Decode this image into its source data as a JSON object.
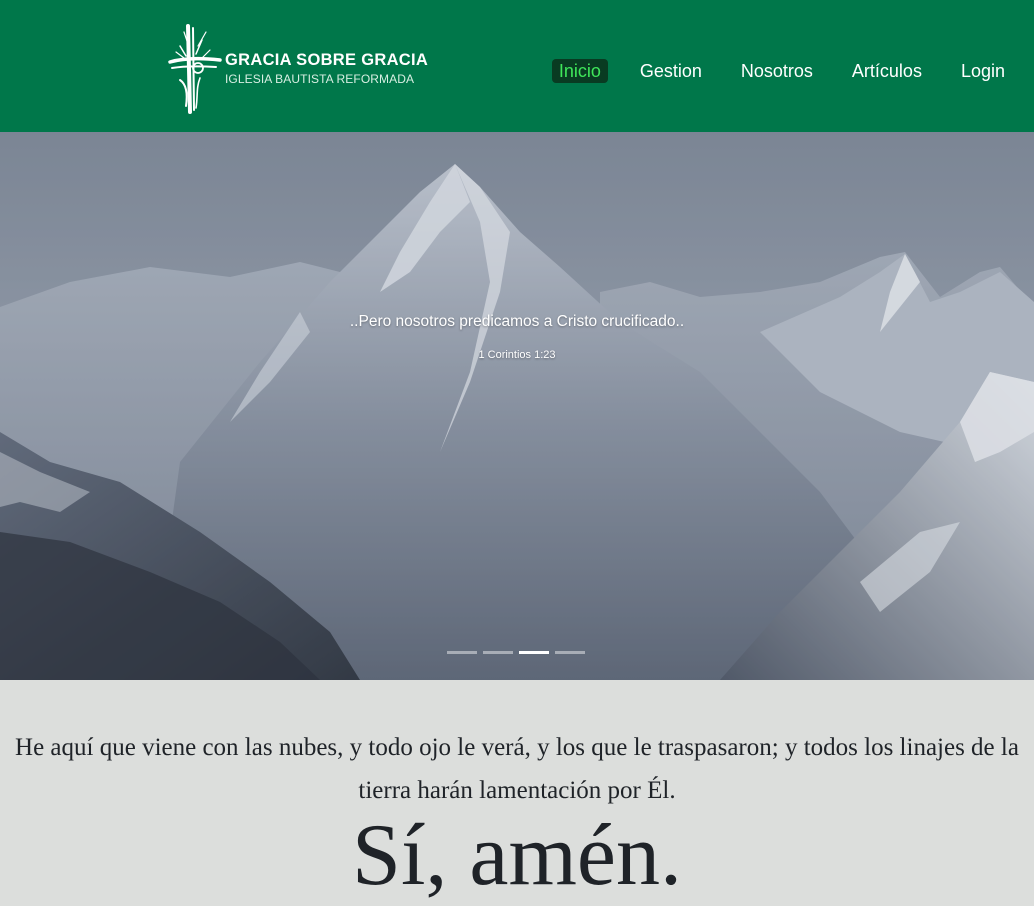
{
  "brand": {
    "title": "GRACIA SOBRE GRACIA",
    "subtitle": "IGLESIA BAUTISTA REFORMADA",
    "icon": "cross-logo-icon"
  },
  "nav": {
    "items": [
      {
        "label": "Inicio",
        "active": true
      },
      {
        "label": "Gestion",
        "active": false
      },
      {
        "label": "Nosotros",
        "active": false
      },
      {
        "label": "Artículos",
        "active": false
      },
      {
        "label": "Login",
        "active": false
      }
    ]
  },
  "hero": {
    "quote": "..Pero nosotros predicamos a Cristo crucificado..",
    "reference": "1 Corintios 1:23",
    "slide_count": 4,
    "active_slide": 3
  },
  "content": {
    "verse": "He aquí que viene con las nubes, y todo ojo le verá, y los que le traspasaron; y todos los linajes de la tierra harán lamentación por Él.",
    "amen": "Sí, amén."
  },
  "colors": {
    "navbar": "#00774a",
    "active_bg": "#093b22",
    "active_text": "#3fe65a",
    "page_bg": "#dcdedc",
    "text": "#1f2328"
  }
}
